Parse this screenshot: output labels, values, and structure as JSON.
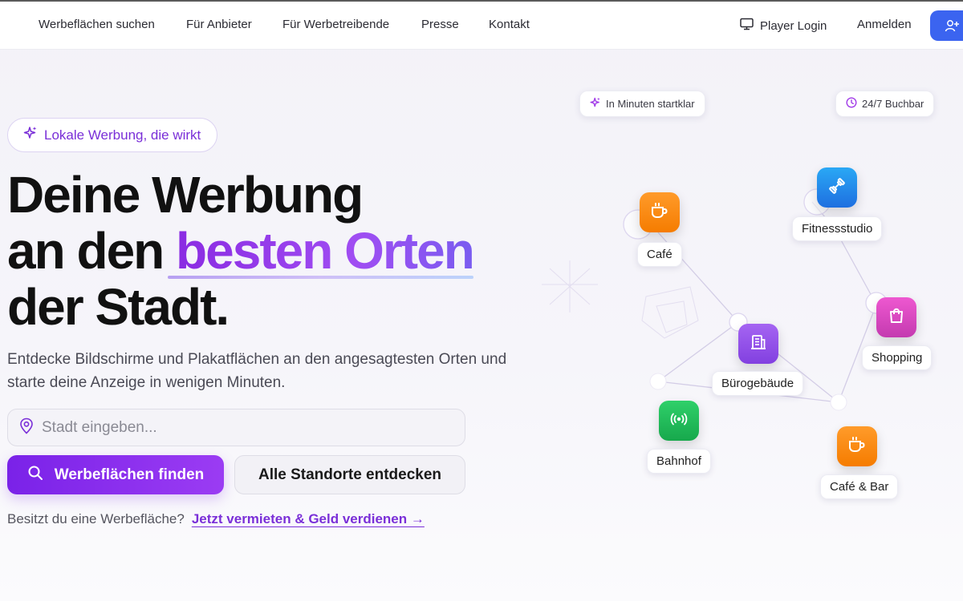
{
  "nav": {
    "links": [
      "Werbeflächen suchen",
      "Für Anbieter",
      "Für Werbetreibende",
      "Presse",
      "Kontakt"
    ],
    "player_login": "Player Login",
    "login": "Anmelden",
    "register_icon": "user-plus-icon"
  },
  "hero": {
    "badge": "Lokale Werbung, die wirkt",
    "headline_line1": "Deine Werbung",
    "headline_line2_prefix": "an den ",
    "headline_line2_highlight": "besten Orten",
    "headline_line3": "der Stadt",
    "headline_line3_suffix": ".",
    "description": "Entdecke Bildschirme und Plakatflächen an den angesagtesten Orten und starte deine Anzeige in wenigen Minuten.",
    "search_placeholder": "Stadt eingeben...",
    "primary_button": "Werbeflächen finden",
    "secondary_button": "Alle Standorte entdecken",
    "owner_question": "Besitzt du eine Werbefläche?",
    "owner_link": "Jetzt vermieten & Geld verdienen →"
  },
  "network": {
    "chip_left": "In Minuten startklar",
    "chip_right": "24/7 Buchbar",
    "locations": [
      {
        "label": "Café",
        "icon": "coffee-cup-icon",
        "color": "#f57c00"
      },
      {
        "label": "Fitnessstudio",
        "icon": "dumbbell-icon",
        "color": "#1e88e5"
      },
      {
        "label": "Shopping",
        "icon": "shopping-bag-icon",
        "color": "#d63ab5"
      },
      {
        "label": "Bürogebäude",
        "icon": "office-building-icon",
        "color": "#8e44e8"
      },
      {
        "label": "Bahnhof",
        "icon": "broadcast-icon",
        "color": "#1fb45a"
      },
      {
        "label": "Café & Bar",
        "icon": "coffee-cup-icon",
        "color": "#f57c00"
      }
    ]
  },
  "colors": {
    "accent_purple": "#7a22e8",
    "nav_button_blue": "#3b64f0"
  }
}
